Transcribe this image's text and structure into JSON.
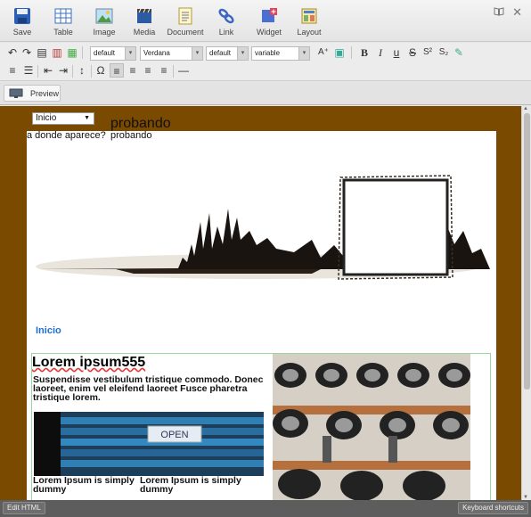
{
  "ribbon": {
    "items": [
      {
        "label": "Save",
        "icon": "save-icon"
      },
      {
        "label": "Table",
        "icon": "table-icon"
      },
      {
        "label": "Image",
        "icon": "image-icon"
      },
      {
        "label": "Media",
        "icon": "media-icon"
      },
      {
        "label": "Document",
        "icon": "document-icon"
      },
      {
        "label": "Link",
        "icon": "link-icon"
      },
      {
        "label": "Widget",
        "icon": "widget-icon"
      },
      {
        "label": "Layout",
        "icon": "layout-icon"
      }
    ]
  },
  "format": {
    "style": "default",
    "font": "Verdana",
    "size": "default",
    "variable": "variable"
  },
  "preview": {
    "label": "Preview"
  },
  "content": {
    "dropdown": "Inicio",
    "probando_big": "probando",
    "question": "a donde aparece?",
    "probando_small": "probando",
    "inicio_link": "Inicio",
    "heading": "Lorem ipsum555",
    "paragraph": "Suspendisse vestibulum tristique commodo. Donec laoreet, enim vel eleifend laoreet Fusce pharetra tristique lorem.",
    "lorem_a": "Lorem Ipsum is simply dummy",
    "lorem_b": "Lorem Ipsum is simply dummy",
    "folder_label": "OPEN"
  },
  "bottom": {
    "edit_html": "Edit HTML",
    "shortcuts": "Keyboard shortcuts"
  },
  "colors": {
    "canvas": "#7a4a00",
    "accent": "#1f6fd0"
  }
}
